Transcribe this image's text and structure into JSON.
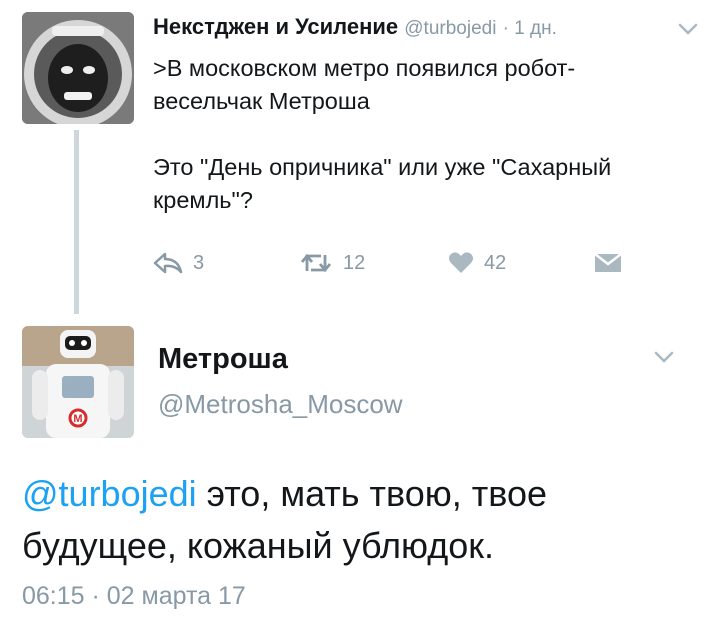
{
  "tweet1": {
    "display_name": "Некстджен и Усиление",
    "handle": "@turbojedi",
    "time": "· 1 дн.",
    "text_line1": ">В московском метро появился робот-",
    "text_line2": "весельчак Метроша",
    "text_line3": "Это \"День опричника\" или уже \"Сахарный",
    "text_line4": "кремль\"?",
    "actions": {
      "reply_count": "3",
      "retweet_count": "12",
      "like_count": "42"
    }
  },
  "tweet2": {
    "display_name": "Метроша",
    "handle": "@Metrosha_Moscow",
    "mention": "@turbojedi",
    "text_rest": " это, мать твою, твое будущее, кожаный ублюдок.",
    "timestamp": "06:15 · 02 марта 17"
  },
  "icons": {
    "reply": "reply-icon",
    "retweet": "retweet-icon",
    "like": "heart-icon",
    "dm": "direct-message-icon",
    "menu": "chevron-down-icon"
  },
  "colors": {
    "text": "#14171a",
    "muted": "#8899a6",
    "link": "#1da1f2",
    "thread_line": "#ccd6dd"
  }
}
